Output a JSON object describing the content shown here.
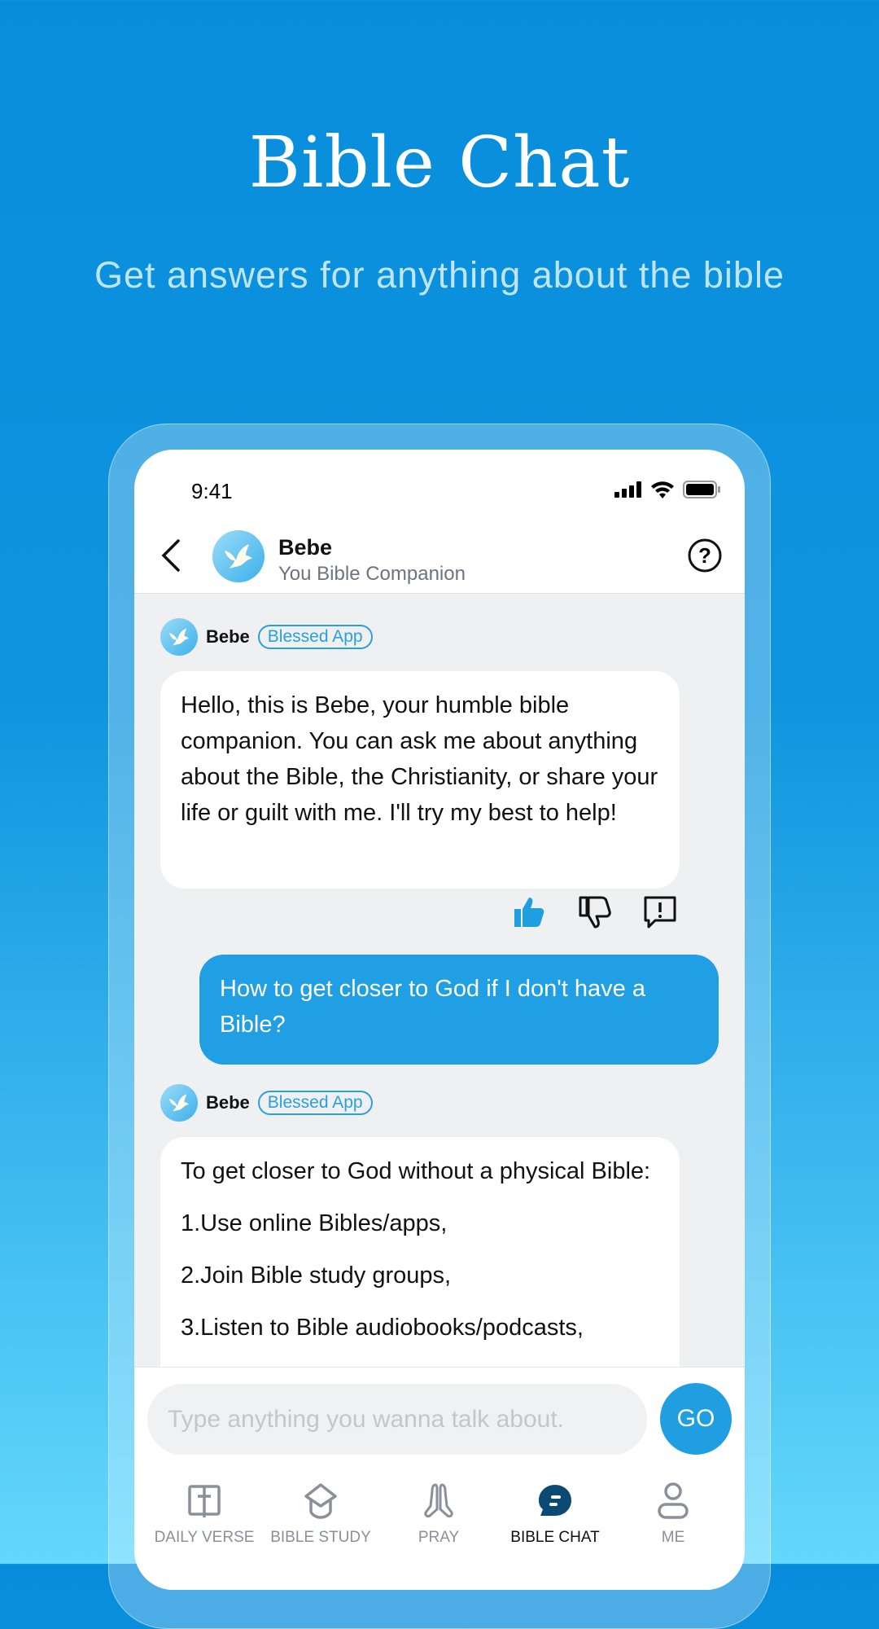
{
  "hero": {
    "title": "Bible Chat",
    "subtitle": "Get answers for anything about the bible"
  },
  "status_bar": {
    "time": "9:41"
  },
  "header": {
    "name": "Bebe",
    "subtitle": "You Bible Companion"
  },
  "messages": [
    {
      "sender": "Bebe",
      "badge": "Blessed App",
      "lines": [
        "Hello, this is Bebe, your humble bible companion. You can ask me about anything about the Bible, the Christianity, or share your life or guilt with me. I'll try my best to help!"
      ]
    },
    {
      "sender": "user",
      "text": "How to get closer to God if I don't have a Bible?"
    },
    {
      "sender": "Bebe",
      "badge": "Blessed App",
      "lines": [
        "To get closer to God without a physical Bible:",
        "1.Use online Bibles/apps,",
        "2.Join Bible study groups,",
        "3.Listen to Bible audiobooks/podcasts,"
      ]
    }
  ],
  "input": {
    "placeholder": "Type anything you wanna talk about.",
    "value": "",
    "send_label": "GO"
  },
  "tabs": [
    {
      "label": "DAILY VERSE",
      "icon": "book-icon"
    },
    {
      "label": "BIBLE STUDY",
      "icon": "graduation-cap-icon"
    },
    {
      "label": "PRAY",
      "icon": "praying-hands-icon"
    },
    {
      "label": "BIBLE CHAT",
      "icon": "chat-bubble-icon",
      "active": true
    },
    {
      "label": "ME",
      "icon": "person-icon"
    }
  ],
  "colors": {
    "accent": "#219fe4",
    "active_tab": "#0b4a73",
    "chat_bg": "#eff0f2"
  }
}
